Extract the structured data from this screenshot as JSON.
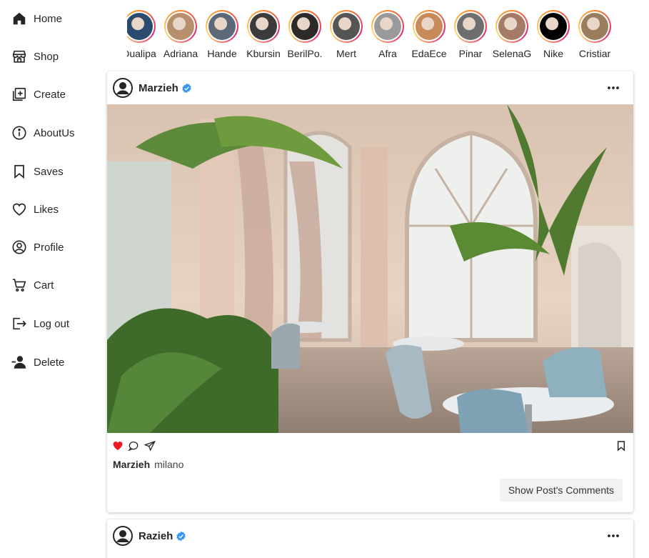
{
  "sidebar": {
    "items": [
      {
        "label": "Home",
        "icon": "home-icon"
      },
      {
        "label": "Shop",
        "icon": "shop-icon"
      },
      {
        "label": "Create",
        "icon": "create-icon"
      },
      {
        "label": "AboutUs",
        "icon": "info-icon"
      },
      {
        "label": "Saves",
        "icon": "bookmark-icon"
      },
      {
        "label": "Likes",
        "icon": "heart-icon"
      },
      {
        "label": "Profile",
        "icon": "profile-icon"
      },
      {
        "label": "Cart",
        "icon": "cart-icon"
      },
      {
        "label": "Log out",
        "icon": "logout-icon"
      },
      {
        "label": "Delete",
        "icon": "delete-user-icon"
      }
    ]
  },
  "stories": [
    {
      "name": "Dualipa",
      "color": "#2a4a6e"
    },
    {
      "name": "Adriana",
      "color": "#b88f6c"
    },
    {
      "name": "Hande",
      "color": "#5a6878"
    },
    {
      "name": "Kbursin",
      "color": "#3b3b3b"
    },
    {
      "name": "BerilPo.",
      "color": "#2e2a28"
    },
    {
      "name": "Mert",
      "color": "#555555"
    },
    {
      "name": "Afra",
      "color": "#9a9a9a"
    },
    {
      "name": "EdaEce",
      "color": "#c98a5a"
    },
    {
      "name": "Pinar",
      "color": "#6e6e6e"
    },
    {
      "name": "SelenaG",
      "color": "#a57a66"
    },
    {
      "name": "Nike",
      "color": "#000000"
    },
    {
      "name": "Cristiar",
      "color": "#9a7d5c"
    }
  ],
  "posts": [
    {
      "user": "Marzieh",
      "caption": "milano",
      "comments_button": "Show Post's Comments",
      "liked": true
    },
    {
      "user": "Razieh"
    }
  ],
  "colors": {
    "like": "#ed1c24",
    "verified": "#3897f0"
  }
}
